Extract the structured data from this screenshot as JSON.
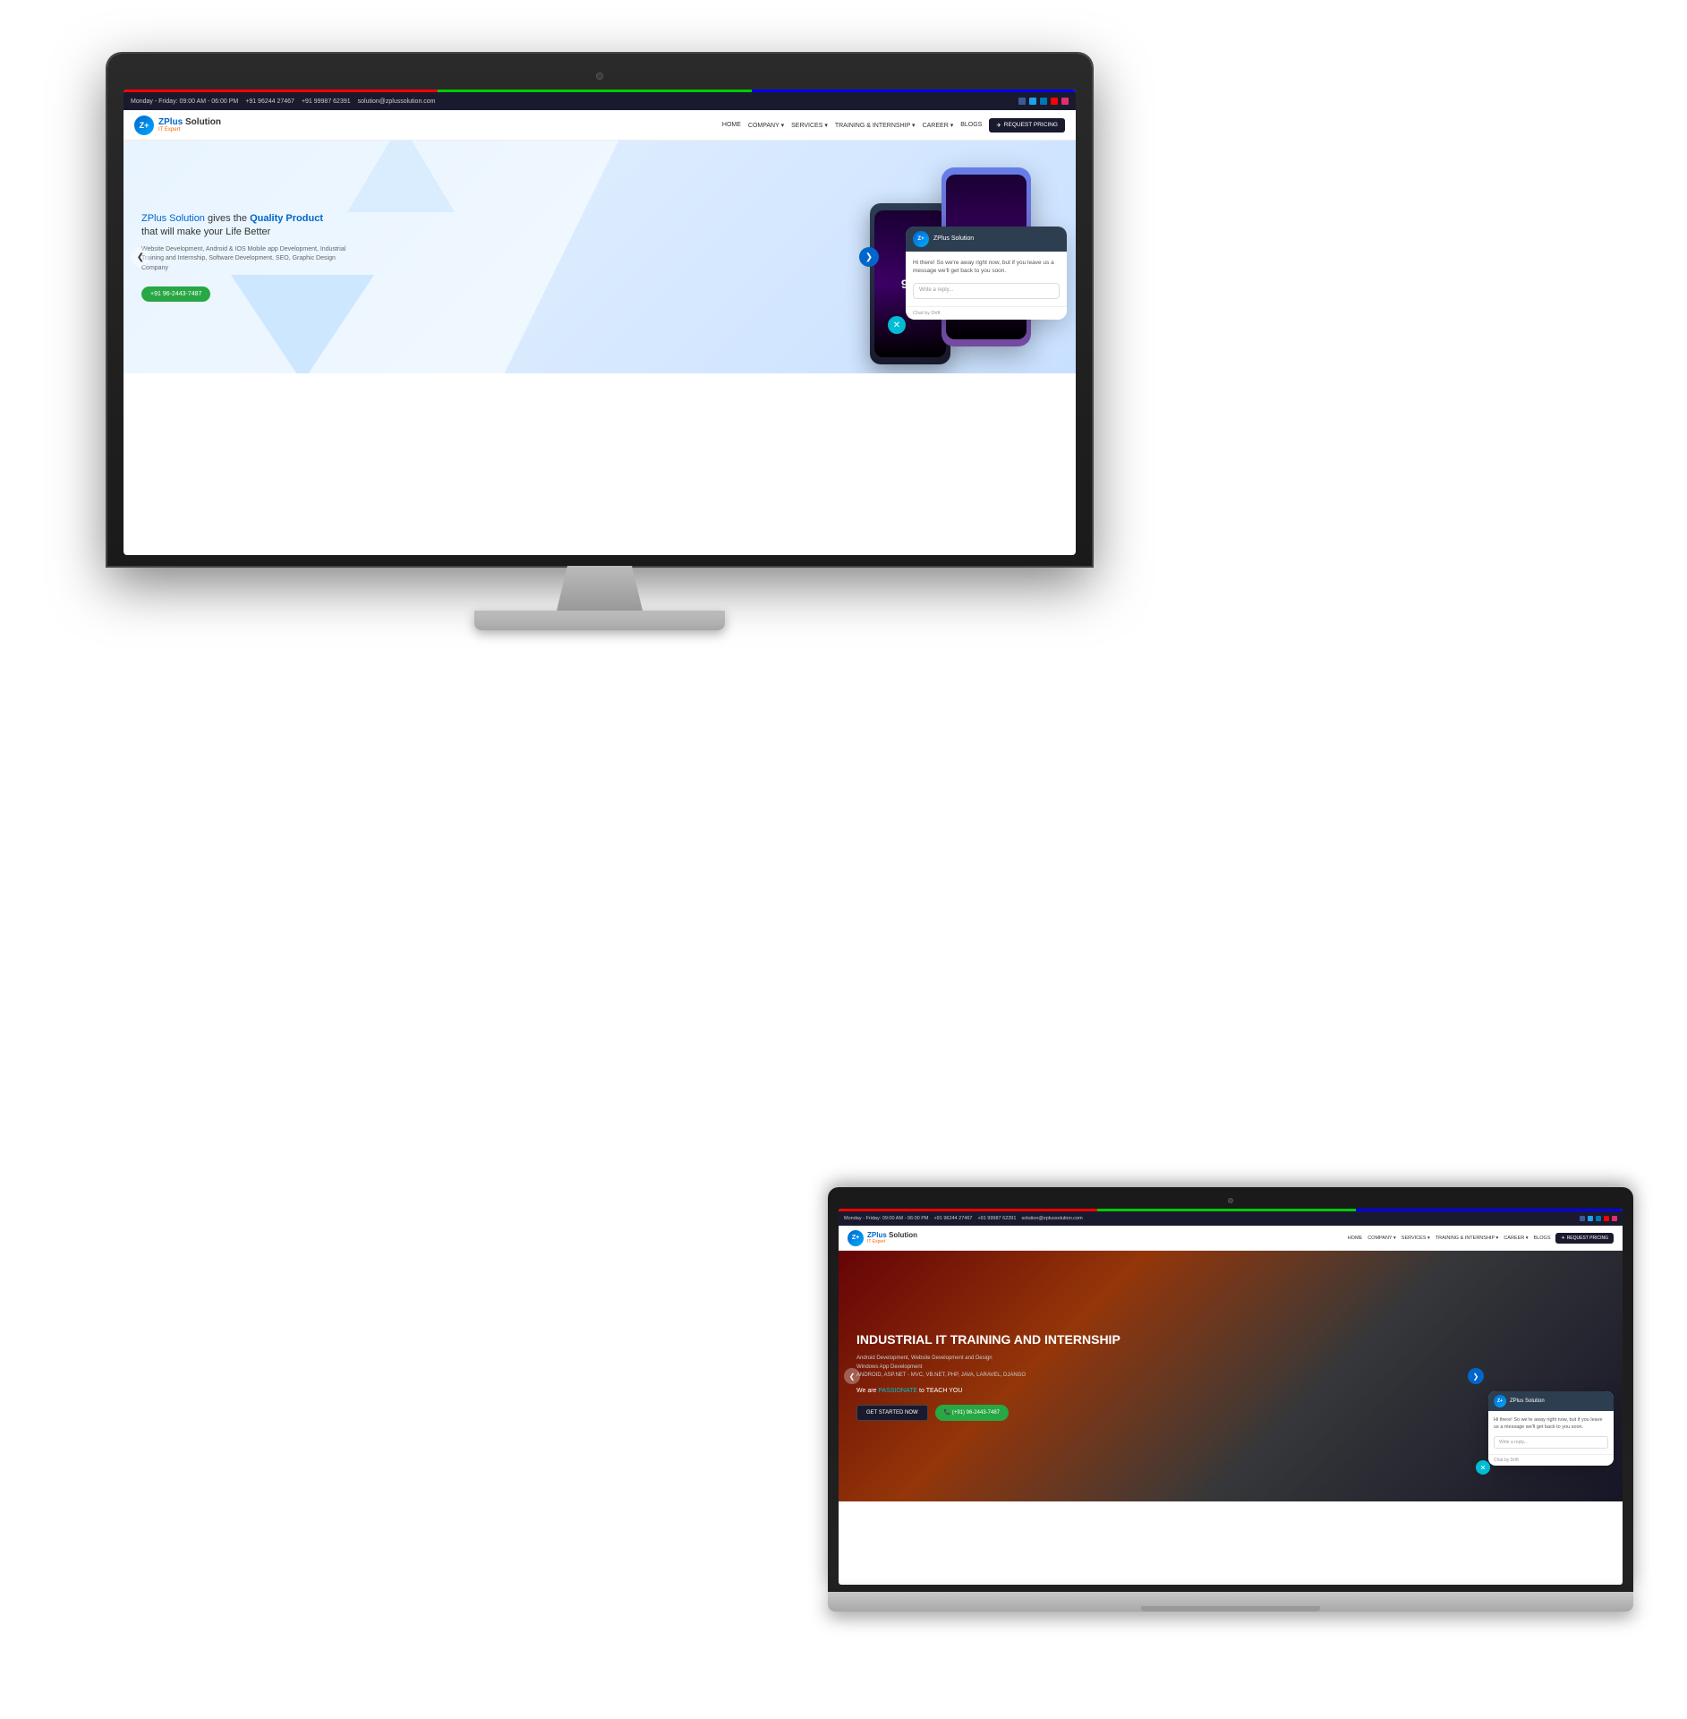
{
  "monitor": {
    "topbar": {
      "hours": "Monday - Friday: 09:00 AM - 06:00 PM",
      "phone1": "+91 96244 27467",
      "phone2": "+91 99987 62391",
      "email": "solution@zplussolution.com"
    },
    "navbar": {
      "logo_letter": "Z+",
      "brand_name": "ZPlus Solution",
      "brand_sub": "IT Expert",
      "nav_items": [
        "HOME",
        "COMPANY",
        "SERVICES",
        "TRAINING & INTERNSHIP",
        "CAREER",
        "BLOGS"
      ],
      "cta_label": "REQUEST PRICING"
    },
    "hero": {
      "title_line1": "ZPlus Solution gives the Quality Product",
      "title_line2": "that will make your Life Better",
      "subtitle": "Website Development, Android & IOS Mobile app Development, Industrial Training and Internship, Software Development, SEO, Graphic Design Company",
      "phone_btn": "+91 96-2443-7487"
    },
    "chat": {
      "company": "ZPlus Solution",
      "greeting": "Hi there! So we're away right now, but if you leave us a message we'll get back to you soon.",
      "placeholder": "Write a reply...",
      "footer": "Chat by Drift"
    }
  },
  "laptop": {
    "topbar": {
      "hours": "Monday - Friday: 09:00 AM - 06:00 PM",
      "phone1": "+91 96244 27467",
      "phone2": "+91 99987 62391",
      "email": "solution@zplussolution.com"
    },
    "navbar": {
      "logo_letter": "Z+",
      "brand_name": "ZPlus Solution",
      "brand_sub": "IT Expert",
      "nav_items": [
        "HOME",
        "COMPANY",
        "SERVICES",
        "TRAINING & INTERNSHIP",
        "CAREER",
        "BLOGS"
      ],
      "cta_label": "REQUEST PRICING"
    },
    "hero": {
      "title": "INDUSTRIAL IT TRAINING AND INTERNSHIP",
      "subtitle_line1": "Android Development, Website Development and Design",
      "subtitle_line2": "Windows App Development",
      "subtitle_line3": "ANDROID, ASP.NET - MVC, VB.NET, PHP, JAVA, LARAVEL, DJANGO",
      "passion_text": "We are PASSIONATE to TEACH YOU",
      "btn_started": "GET STARTED NOW",
      "btn_phone": "(+91) 96-2443-7487"
    },
    "chat": {
      "company": "ZPlus Solution",
      "greeting": "Hi there! So we're away right now, but if you leave us a message we'll get back to you soon.",
      "placeholder": "Write a reply...",
      "footer": "Chat by Drift"
    }
  },
  "icons": {
    "prev_arrow": "❮",
    "next_arrow": "❯",
    "close": "✕",
    "plane": "✈",
    "phone_icon": "📞"
  }
}
